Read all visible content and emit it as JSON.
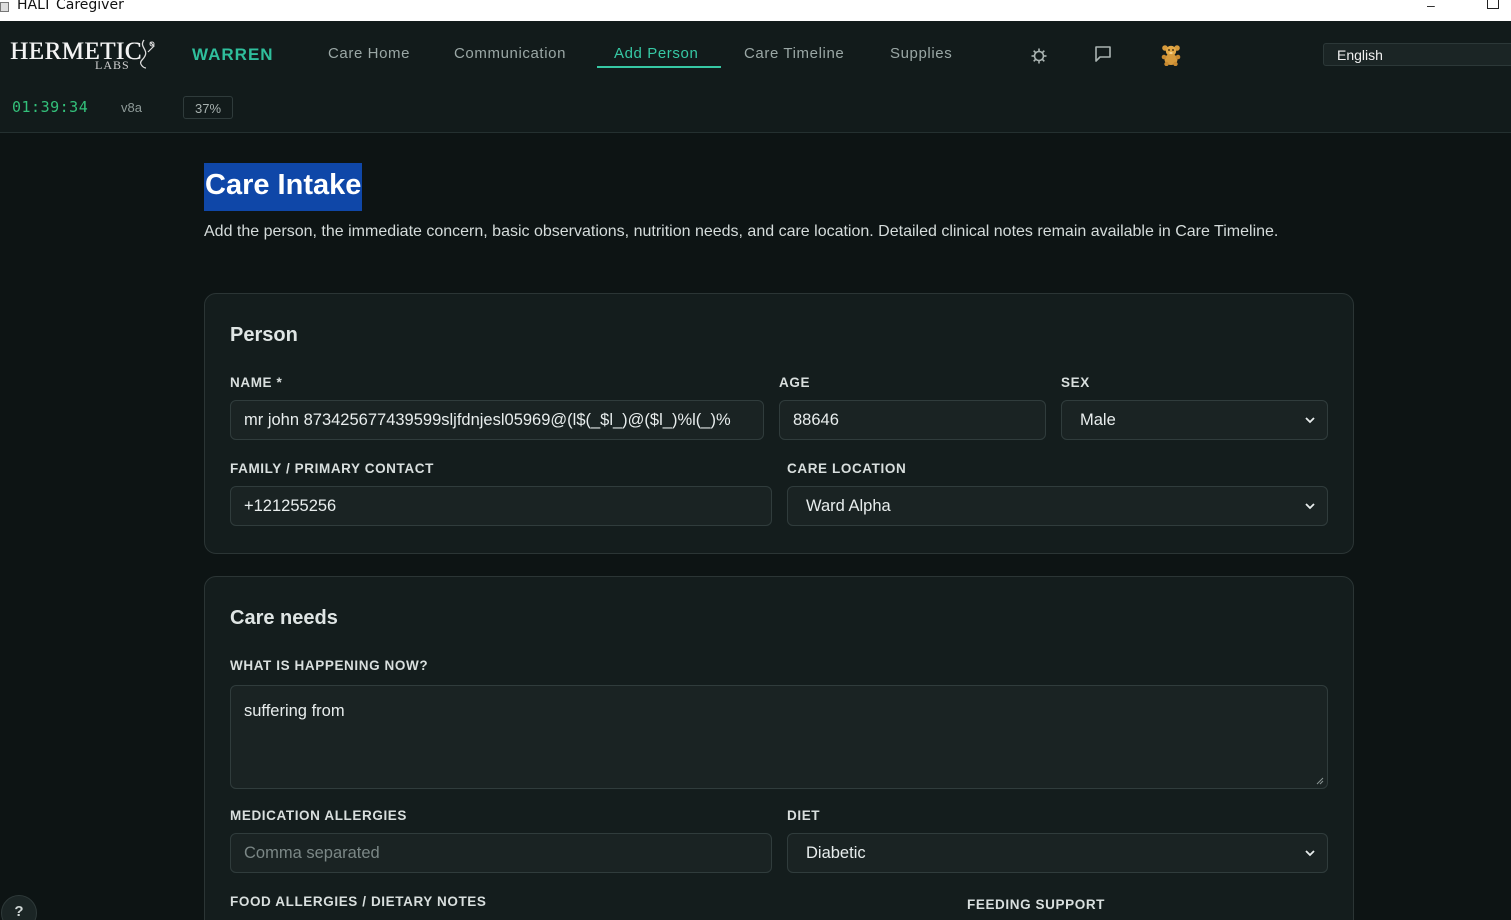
{
  "window": {
    "title": "HALT Caregiver",
    "minimize": "–"
  },
  "header": {
    "logo": {
      "word": "HERMETIC",
      "sub": "LABS"
    },
    "user": "WARREN",
    "tabs": [
      {
        "label": "Care Home",
        "active": false
      },
      {
        "label": "Communication",
        "active": false
      },
      {
        "label": "Add Person",
        "active": true
      },
      {
        "label": "Care Timeline",
        "active": false
      },
      {
        "label": "Supplies",
        "active": false
      }
    ],
    "icons": [
      "gear-icon",
      "chat-icon",
      "teddy-bear-icon"
    ],
    "language": "English",
    "clock": "01:39:34",
    "version": "v8a",
    "percent": "37%"
  },
  "page": {
    "title": "Care Intake",
    "description": "Add the person, the immediate concern, basic observations, nutrition needs, and care location. Detailed clinical notes remain available in Care Timeline."
  },
  "person": {
    "heading": "Person",
    "name_label": "NAME *",
    "name_value": "mr john 873425677439599sljfdnjesl05969@(l$(_$l_)@($l_)%l(_)%",
    "age_label": "AGE",
    "age_value": "88646",
    "sex_label": "SEX",
    "sex_value": "Male",
    "contact_label": "FAMILY / PRIMARY CONTACT",
    "contact_value": "+121255256",
    "location_label": "CARE LOCATION",
    "location_value": "Ward Alpha"
  },
  "care_needs": {
    "heading": "Care needs",
    "happening_label": "WHAT IS HAPPENING NOW?",
    "happening_value": "suffering from",
    "allergies_label": "MEDICATION ALLERGIES",
    "allergies_placeholder": "Comma separated",
    "diet_label": "DIET",
    "diet_value": "Diabetic",
    "food_label": "FOOD ALLERGIES / DIETARY NOTES",
    "feeding_label": "FEEDING SUPPORT"
  },
  "help": "?",
  "colors": {
    "accent": "#36c8a4",
    "clock": "#33c07a",
    "selection": "#0f47a8",
    "background": "#0d1414"
  }
}
